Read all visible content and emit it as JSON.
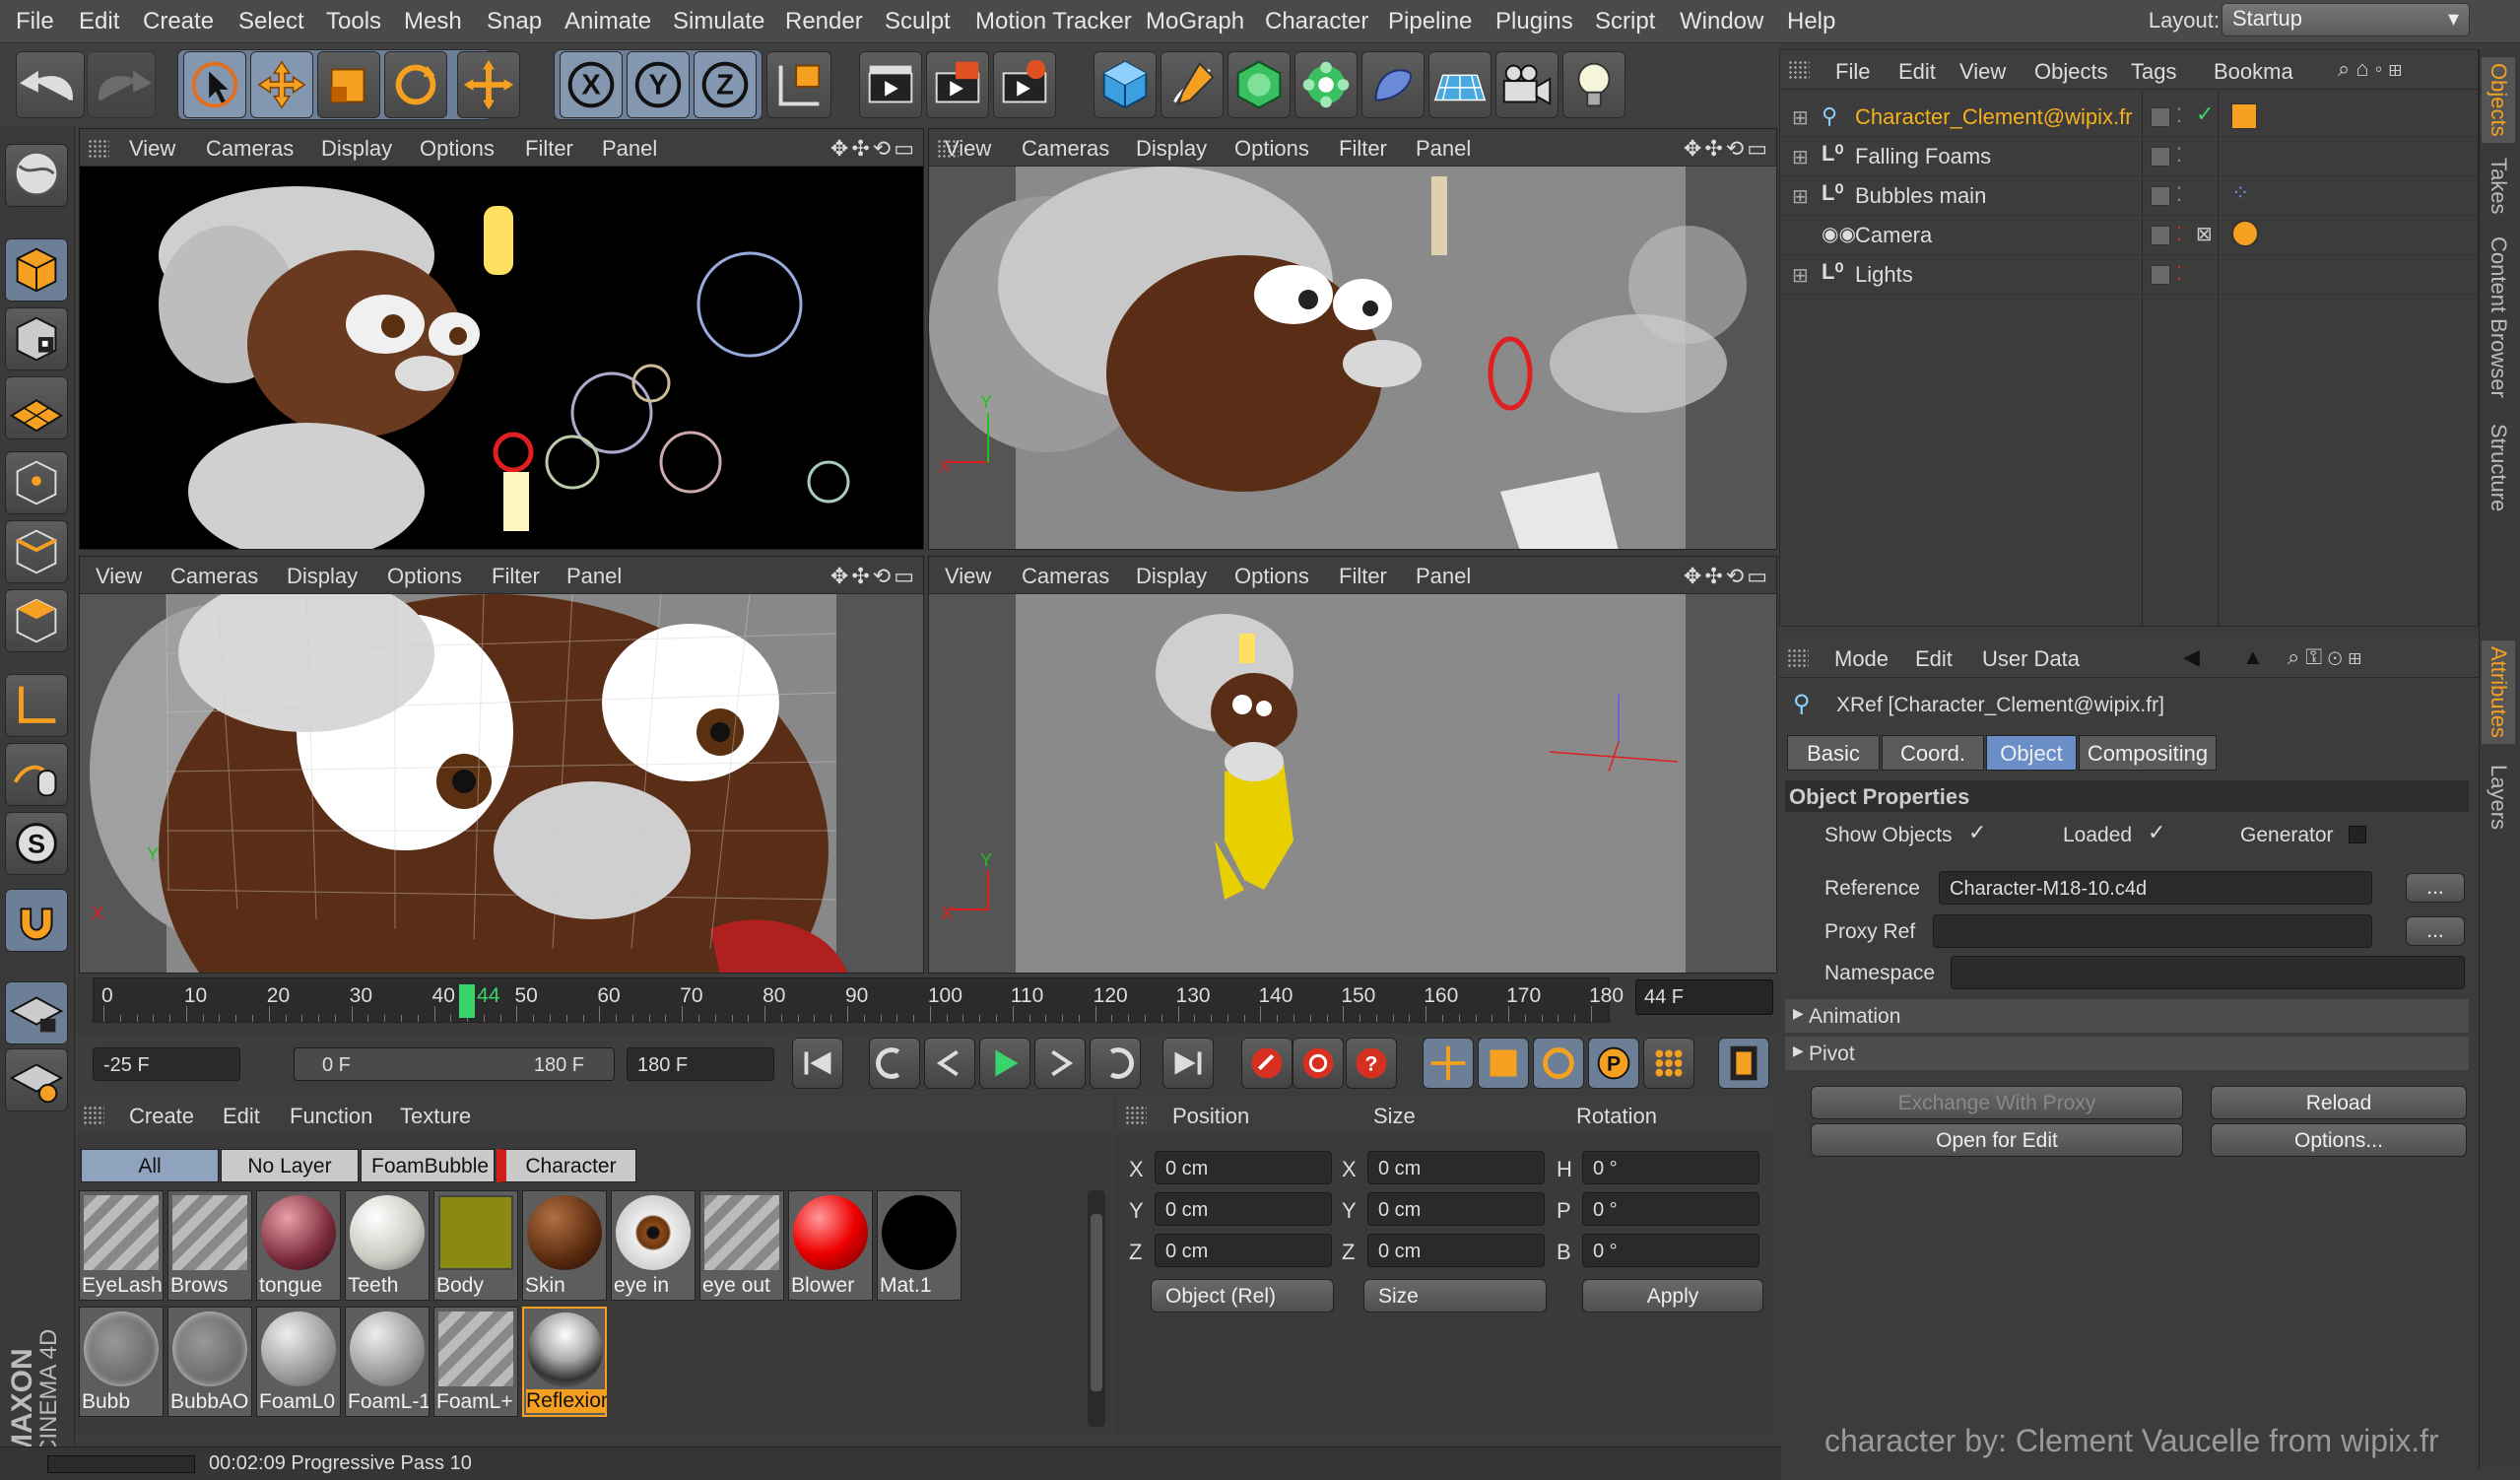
{
  "menu": {
    "items": [
      "File",
      "Edit",
      "Create",
      "Select",
      "Tools",
      "Mesh",
      "Snap",
      "Animate",
      "Simulate",
      "Render",
      "Sculpt",
      "Motion Tracker",
      "MoGraph",
      "Character",
      "Pipeline",
      "Plugins",
      "Script",
      "Window",
      "Help"
    ],
    "layout_label": "Layout:",
    "layout_value": "Startup"
  },
  "viewports": {
    "menu": [
      "View",
      "Cameras",
      "Display",
      "Options",
      "Filter",
      "Panel"
    ],
    "icons": "✥✣⟲▭"
  },
  "timeline": {
    "ticks": [
      "0",
      "10",
      "20",
      "30",
      "40",
      "44",
      "50",
      "60",
      "70",
      "80",
      "90",
      "100",
      "110",
      "120",
      "130",
      "140",
      "150",
      "160",
      "170",
      "180"
    ],
    "current_frame": 44,
    "max_frame": 180,
    "end_field": "44 F"
  },
  "transport": {
    "start": "-25 F",
    "range_start": "0 F",
    "range_end": "180 F",
    "end": "180 F"
  },
  "materials": {
    "menu": [
      "Create",
      "Edit",
      "Function",
      "Texture"
    ],
    "tabs": [
      "All",
      "No Layer",
      "FoamBubble",
      "Character"
    ],
    "row1": [
      "EyeLash",
      "Brows",
      "tongue",
      "Teeth",
      "Body",
      "Skin",
      "eye in",
      "eye out",
      "Blower",
      "Mat.1"
    ],
    "row2": [
      "Bubb",
      "BubbAO",
      "FoamL0",
      "FoamL-1",
      "FoamL+",
      "Reflexion"
    ]
  },
  "coords": {
    "headers": [
      "Position",
      "Size",
      "Rotation"
    ],
    "pos": {
      "x": "0 cm",
      "y": "0 cm",
      "z": "0 cm"
    },
    "size": {
      "x": "0 cm",
      "y": "0 cm",
      "z": "0 cm"
    },
    "rot": {
      "h": "0 °",
      "p": "0 °",
      "b": "0 °"
    },
    "axis_labels": [
      "X",
      "Y",
      "Z"
    ],
    "rot_labels": [
      "H",
      "P",
      "B"
    ],
    "mode": "Object (Rel)",
    "size_mode": "Size",
    "apply": "Apply"
  },
  "object_manager": {
    "menu": [
      "File",
      "Edit",
      "View",
      "Objects",
      "Tags",
      "Bookma"
    ],
    "objects": [
      {
        "name": "Character_Clement@wipix.fr",
        "highlight": true
      },
      {
        "name": "Falling Foams"
      },
      {
        "name": "Bubbles main"
      },
      {
        "name": "Camera"
      },
      {
        "name": "Lights"
      }
    ]
  },
  "attributes": {
    "menu": [
      "Mode",
      "Edit",
      "User Data"
    ],
    "title": "XRef [Character_Clement@wipix.fr]",
    "tabs": [
      "Basic",
      "Coord.",
      "Object",
      "Compositing"
    ],
    "active_tab": "Object",
    "section": "Object Properties",
    "show_objects": "Show Objects",
    "loaded": "Loaded",
    "generator": "Generator",
    "reference_label": "Reference",
    "reference_value": "Character-M18-10.c4d",
    "proxy_label": "Proxy Ref",
    "namespace_label": "Namespace",
    "animation": "Animation",
    "pivot": "Pivot",
    "buttons": [
      "Exchange With Proxy",
      "Reload",
      "Open for Edit",
      "Options..."
    ],
    "ellipsis": "..."
  },
  "sidetabs": [
    "Objects",
    "Takes",
    "Content Browser",
    "Structure",
    "Attributes",
    "Layers"
  ],
  "status": {
    "text": "00:02:09 Progressive Pass 10"
  },
  "brand": {
    "maxon": "MAXON",
    "cinema": "CINEMA 4D"
  },
  "credit": "character by: Clement Vaucelle from wipix.fr"
}
